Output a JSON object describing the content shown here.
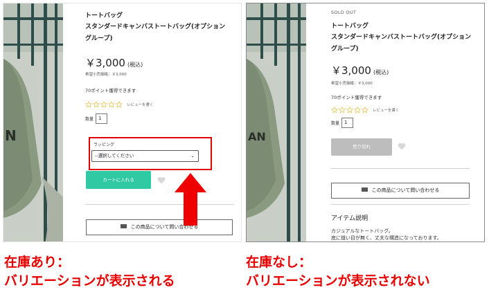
{
  "colors": {
    "cart_button": "#2fc9a3",
    "sold_out_button": "#bdbdbd",
    "highlight": "#e00000",
    "caption": "#e60000",
    "star_outline": "#e8c14a"
  },
  "left": {
    "category": "トートバッグ",
    "product_name": "スタンダードキャンバストートバッグ(オプショングループ)",
    "price": "￥3,000",
    "tax_note": "(税込)",
    "msrp": "希望小売価格：￥3,000",
    "points": "70ポイント獲得できます",
    "review_link": "レビューを書く",
    "rating": 0,
    "quantity_label": "数量",
    "quantity_value": "1",
    "variation_label": "ラッピング",
    "select_value": "--選択してください",
    "cart_button": "カートに入れる",
    "inquiry_button": "この商品について問い合わせる"
  },
  "right": {
    "sold_out": "SOLD OUT",
    "category": "トートバッグ",
    "product_name": "スタンダードキャンバストートバッグ(オプショングループ)",
    "price": "￥3,000",
    "tax_note": "(税込)",
    "msrp": "希望小売価格：￥3,000",
    "points": "70ポイント獲得できます",
    "review_link": "レビューを書く",
    "rating": 0,
    "quantity_label": "数量",
    "quantity_value": "1",
    "sold_out_button": "売り切れ",
    "inquiry_button": "この商品について問い合わせる",
    "item_desc_title": "アイテム説明",
    "item_desc_line1": "カジュアルなトートバッグ。",
    "item_desc_line2": "底に縫い目が無く、丈夫な構造になっております。"
  },
  "captions": {
    "left_line1": "在庫あり：",
    "left_line2": "バリエーションが表示される",
    "right_line1": "在庫なし：",
    "right_line2": "バリエーションが表示されない"
  },
  "icons": {
    "mail": "mail-icon",
    "heart": "heart-icon",
    "star": "star-outline-icon",
    "chevron": "chevron-down-icon"
  }
}
